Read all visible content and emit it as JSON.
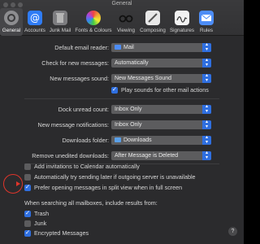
{
  "window": {
    "title": "General"
  },
  "toolbar": {
    "items": [
      {
        "label": "General",
        "icon": "gear-icon",
        "color": "#8d8d90"
      },
      {
        "label": "Accounts",
        "icon": "at-sign-icon",
        "color": "#2f7cf6"
      },
      {
        "label": "Junk Mail",
        "icon": "trash-bin-icon",
        "color": "#8a8a8a"
      },
      {
        "label": "Fonts & Colours",
        "icon": "color-wheel-icon",
        "color": "#d94f9b"
      },
      {
        "label": "Viewing",
        "icon": "glasses-icon",
        "color": "#3a3a3a"
      },
      {
        "label": "Composing",
        "icon": "pencil-note-icon",
        "color": "#e8e8e8"
      },
      {
        "label": "Signatures",
        "icon": "signature-icon",
        "color": "#f2f2f2"
      },
      {
        "label": "Rules",
        "icon": "envelope-icon",
        "color": "#4d8df7"
      }
    ]
  },
  "settings": {
    "default_email_reader": {
      "label": "Default email reader:",
      "value": "Mail"
    },
    "check_new_messages": {
      "label": "Check for new messages:",
      "value": "Automatically"
    },
    "new_messages_sound": {
      "label": "New messages sound:",
      "value": "New Messages Sound"
    },
    "play_sounds": {
      "label": "Play sounds for other mail actions",
      "checked": true
    },
    "dock_unread_count": {
      "label": "Dock unread count:",
      "value": "Inbox Only"
    },
    "new_message_notifications": {
      "label": "New message notifications:",
      "value": "Inbox Only"
    },
    "downloads_folder": {
      "label": "Downloads folder:",
      "value": "Downloads"
    },
    "remove_unedited_downloads": {
      "label": "Remove unedited downloads:",
      "value": "After Message is Deleted"
    },
    "add_invitations": {
      "label": "Add invitations to Calendar automatically",
      "checked": false
    },
    "try_sending_later": {
      "label": "Automatically try sending later if outgoing server is unavailable",
      "checked": false
    },
    "prefer_split_view": {
      "label": "Prefer opening messages in split view when in full screen",
      "checked": true
    },
    "search_heading": "When searching all mailboxes, include results from:",
    "search_trash": {
      "label": "Trash",
      "checked": true
    },
    "search_junk": {
      "label": "Junk",
      "checked": false
    },
    "search_encrypted": {
      "label": "Encrypted Messages",
      "checked": true
    }
  },
  "help_label": "?",
  "accent_color": "#2f6fe0",
  "annotation_color": "#e0352b"
}
